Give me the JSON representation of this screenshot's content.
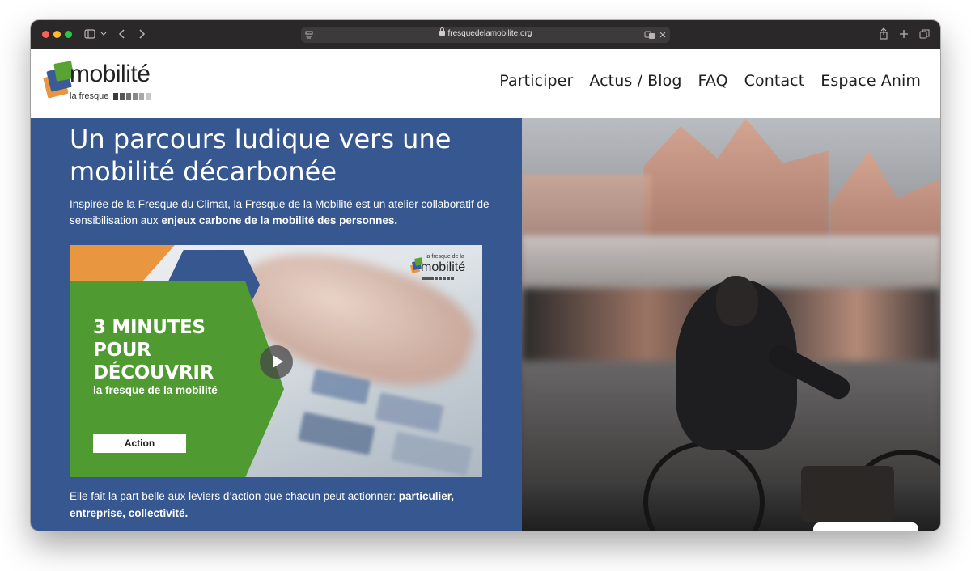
{
  "browser": {
    "url": "fresquedelamobilite.org"
  },
  "header": {
    "logo": {
      "word": "mobilité",
      "sub": "la fresque",
      "bars": [
        "#333333",
        "#555555",
        "#777777",
        "#999999",
        "#aaaaaa",
        "#cccccc"
      ]
    },
    "nav": [
      "Participer",
      "Actus / Blog",
      "FAQ",
      "Contact",
      "Espace Anim"
    ]
  },
  "hero": {
    "title": "Un parcours ludique vers une mobilité décarbonée",
    "intro_plain": "Inspirée de la Fresque du Climat, la Fresque de la Mobilité est un atelier collaboratif de sensibilisation aux ",
    "intro_bold": "enjeux carbone de la mobilité des personnes.",
    "video": {
      "title_line1": "3 MINUTES",
      "title_line2": "POUR",
      "title_line3": "DÉCOUVRIR",
      "subtitle": "la fresque de la mobilité",
      "button": "Action",
      "mini_logo_top": "la fresque de la",
      "mini_logo_word": "mobilité"
    },
    "footer_plain": "Elle fait la part belle aux leviers d’action que chacun peut actionner: ",
    "footer_bold": "particulier, entreprise, collectivité."
  },
  "colors": {
    "hero_blue": "#36578f",
    "brand_green": "#4f9a31",
    "brand_orange": "#e8963f"
  }
}
